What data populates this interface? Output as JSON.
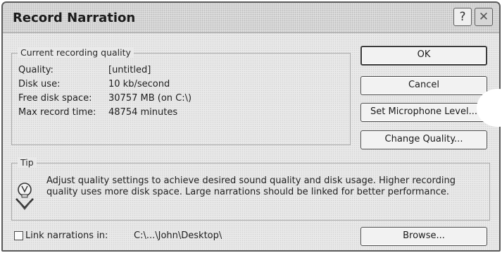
{
  "window": {
    "title": "Record Narration",
    "help_glyph": "?",
    "close_glyph": "✕"
  },
  "quality_group": {
    "label": "Current recording quality",
    "rows": [
      {
        "label": "Quality:",
        "value": "[untitled]"
      },
      {
        "label": "Disk use:",
        "value": "10 kb/second"
      },
      {
        "label": "Free disk space:",
        "value": "30757 MB (on C:\\)"
      },
      {
        "label": "Max record time:",
        "value": "48754 minutes"
      }
    ]
  },
  "buttons": {
    "ok": "OK",
    "cancel": "Cancel",
    "set_microphone": "Set Microphone Level...",
    "change_quality": "Change Quality...",
    "browse": "Browse..."
  },
  "tip": {
    "label": "Tip",
    "text": "Adjust quality settings to achieve desired sound quality and disk usage. Higher recording quality uses more disk space. Large narrations should be linked for better performance.",
    "icon": "lightbulb-icon"
  },
  "link": {
    "label": "Link narrations in:",
    "checked": false,
    "path": "C:\\...\\John\\Desktop\\"
  }
}
